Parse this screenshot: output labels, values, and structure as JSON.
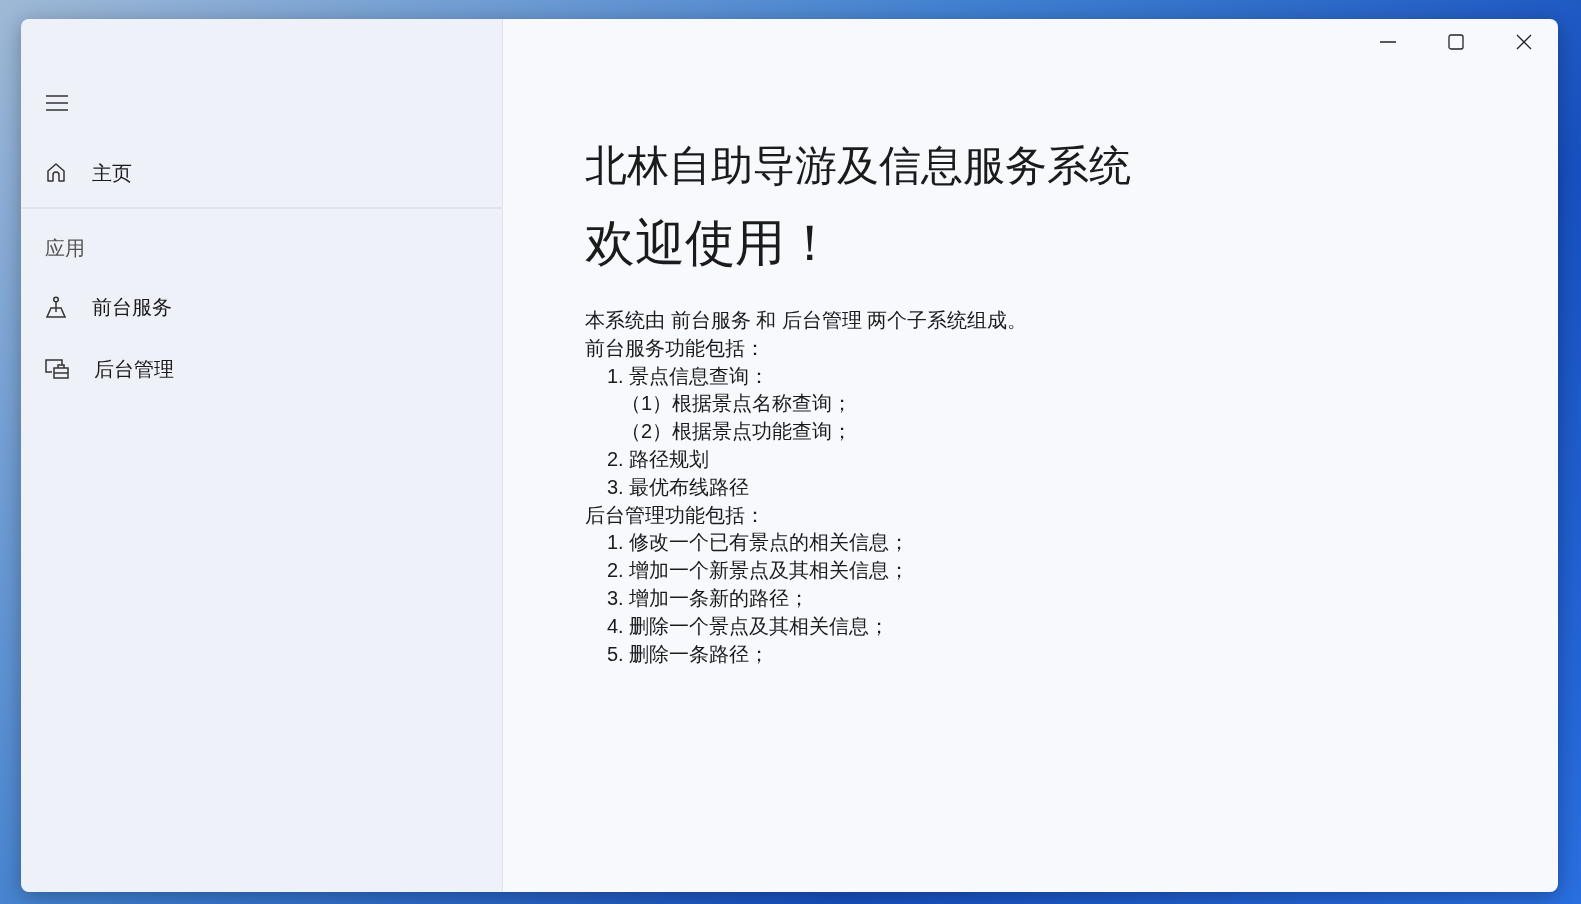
{
  "sidebar": {
    "items": [
      {
        "kind": "nav",
        "label": "主页",
        "selected": false
      },
      {
        "kind": "divider"
      },
      {
        "kind": "header",
        "label": "应用"
      },
      {
        "kind": "nav",
        "label": "前台服务",
        "selected": false
      },
      {
        "kind": "nav",
        "label": "后台管理",
        "selected": false
      }
    ]
  },
  "content": {
    "title": "北林自助导游及信息服务系统",
    "welcome": "欢迎使用！",
    "lines": [
      {
        "text": "本系统由 前台服务 和 后台管理 两个子系统组成。"
      },
      {
        "text": "前台服务功能包括：",
        "children": [
          {
            "text": "1. 景点信息查询：",
            "children": [
              {
                "text": "（1）根据景点名称查询；"
              },
              {
                "text": "（2）根据景点功能查询；"
              }
            ]
          },
          {
            "text": "2. 路径规划"
          },
          {
            "text": "3. 最优布线路径"
          }
        ]
      },
      {
        "text": "后台管理功能包括：",
        "children": [
          {
            "text": "1. 修改一个已有景点的相关信息；"
          },
          {
            "text": "2. 增加一个新景点及其相关信息；"
          },
          {
            "text": "3. 增加一条新的路径；"
          },
          {
            "text": "4. 删除一个景点及其相关信息；"
          },
          {
            "text": "5. 删除一条路径；"
          }
        ]
      }
    ]
  }
}
